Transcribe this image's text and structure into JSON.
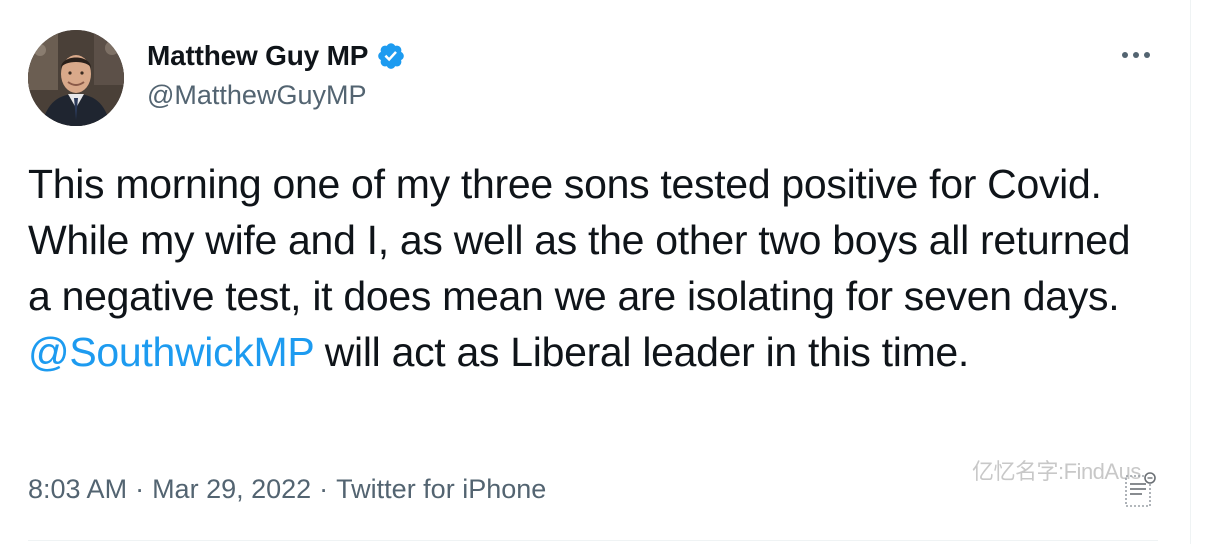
{
  "author": {
    "display_name": "Matthew Guy MP",
    "handle": "@MatthewGuyMP",
    "verified": true,
    "avatar_icon": "profile-photo"
  },
  "tweet": {
    "text_before_mention": "This morning one of my three sons tested positive for Covid. While my wife and I, as well as the other two boys all returned a negative test, it does mean we are isolating for seven days. ",
    "mention": "@SouthwickMP",
    "text_after_mention": " will act as Liberal leader in this time."
  },
  "meta": {
    "time": "8:03 AM",
    "separator": "·",
    "date": "Mar 29, 2022",
    "source": "Twitter for iPhone"
  },
  "watermark": {
    "text": "亿忆名字:FindAus"
  },
  "icons": {
    "more": "more-horizontal-icon",
    "verified": "verified-badge-icon",
    "note": "note-icon"
  },
  "colors": {
    "accent": "#1d9bf0",
    "text_primary": "#0f1419",
    "text_secondary": "#536471"
  }
}
